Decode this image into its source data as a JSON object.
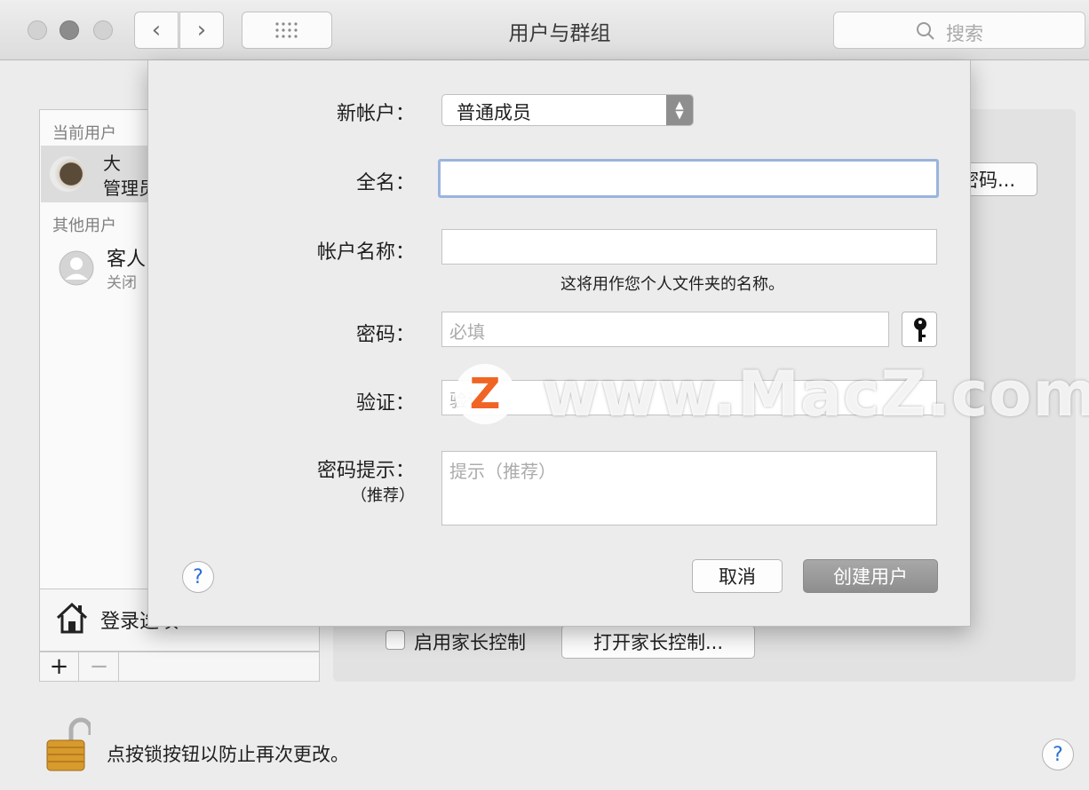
{
  "window": {
    "title": "用户与群组",
    "search_placeholder": "搜索"
  },
  "sidebar": {
    "current_users_label": "当前用户",
    "current_user": {
      "name": "大",
      "role": "管理员"
    },
    "other_users_label": "其他用户",
    "guest_user": {
      "name": "客人",
      "status": "关闭"
    },
    "login_options_label": "登录选项",
    "add_label": "+",
    "remove_label": "−"
  },
  "pane": {
    "change_password_label": "更改密码...",
    "parental_controls_checkbox_label": "启用家长控制",
    "open_parental_controls_label": "打开家长控制...",
    "lock_text": "点按锁按钮以防止再次更改。",
    "help_label": "?"
  },
  "dialog": {
    "new_account_label": "新帐户：",
    "account_type_value": "普通成员",
    "full_name_label": "全名：",
    "full_name_value": "",
    "account_name_label": "帐户名称：",
    "account_name_value": "",
    "account_name_note": "这将用作您个人文件夹的名称。",
    "password_label": "密码：",
    "password_placeholder": "必填",
    "verify_label": "验证：",
    "verify_placeholder": "验证",
    "hint_label": "密码提示：",
    "hint_sublabel": "（推荐）",
    "hint_placeholder": "提示（推荐）",
    "help_label": "?",
    "cancel_label": "取消",
    "create_label": "创建用户"
  },
  "watermark": {
    "logo_letter": "Z",
    "text": "www.MacZ.com",
    "brand_color": "#f06424"
  },
  "colors": {
    "accent_blue": "#2a6fd6",
    "lock_gold": "#d79a2c"
  }
}
